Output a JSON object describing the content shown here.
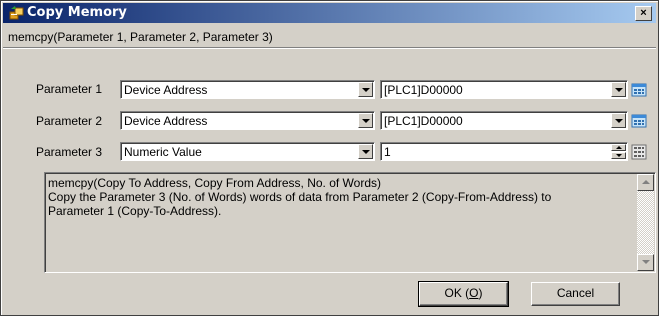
{
  "window": {
    "title": "Copy Memory",
    "close_symbol": "×"
  },
  "header": {
    "signature": "memcpy(Parameter 1, Parameter 2, Parameter 3)"
  },
  "params": [
    {
      "label": "Parameter 1",
      "type_value": "Device Address",
      "value": "[PLC1]D00000",
      "side_icon": "address-picker-icon"
    },
    {
      "label": "Parameter 2",
      "type_value": "Device Address",
      "value": "[PLC1]D00000",
      "side_icon": "address-picker-icon"
    },
    {
      "label": "Parameter 3",
      "type_value": "Numeric Value",
      "value": "1",
      "side_icon": "keypad-icon"
    }
  ],
  "description": {
    "line1": "memcpy(Copy To Address, Copy From Address, No. of Words)",
    "line2": "Copy the Parameter 3 (No. of Words) words of data from Parameter 2 (Copy-From-Address) to",
    "line3": "Parameter 1 (Copy-To-Address)."
  },
  "buttons": {
    "ok_prefix": "OK (",
    "ok_accel": "O",
    "ok_suffix": ")",
    "cancel": "Cancel"
  },
  "colors": {
    "titlebar_start": "#0a246a",
    "titlebar_end": "#a6caf0",
    "face": "#d4d0c8"
  }
}
